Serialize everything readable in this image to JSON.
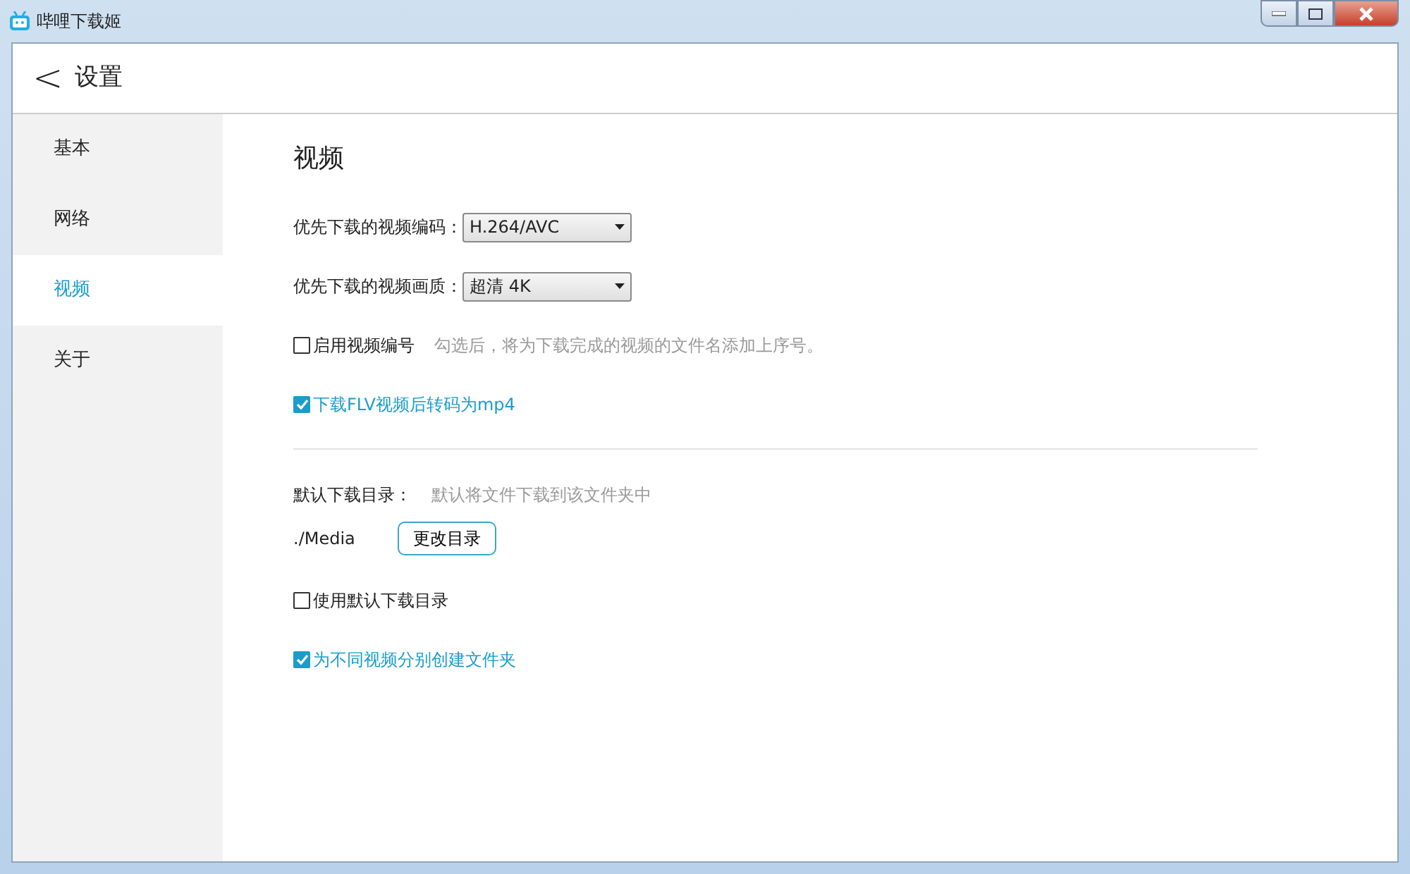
{
  "window": {
    "title": "哔哩下载姬"
  },
  "header": {
    "back": "<",
    "title": "设置"
  },
  "sidebar": {
    "items": [
      {
        "label": "基本",
        "selected": false
      },
      {
        "label": "网络",
        "selected": false
      },
      {
        "label": "视频",
        "selected": true
      },
      {
        "label": "关于",
        "selected": false
      }
    ]
  },
  "content": {
    "title": "视频",
    "options": [
      {
        "kind": "select",
        "label": "优先下载的视频编码：",
        "value": "H.264/AVC"
      },
      {
        "kind": "select",
        "label": "优先下载的视频画质：",
        "value": "超清 4K"
      },
      {
        "kind": "checkbox",
        "label": "启用视频编号",
        "checked": false,
        "hint": "勾选后，将为下载完成的视频的文件名添加上序号。"
      },
      {
        "kind": "checkbox",
        "label": "下载FLV视频后转码为mp4",
        "checked": true
      }
    ],
    "directory": {
      "label": "默认下载目录：",
      "hint": "默认将文件下载到该文件夹中",
      "path": "./Media",
      "button": "更改目录"
    },
    "options2": [
      {
        "kind": "checkbox",
        "label": "使用默认下载目录",
        "checked": false
      },
      {
        "kind": "checkbox",
        "label": "为不同视频分别创建文件夹",
        "checked": true
      }
    ]
  }
}
